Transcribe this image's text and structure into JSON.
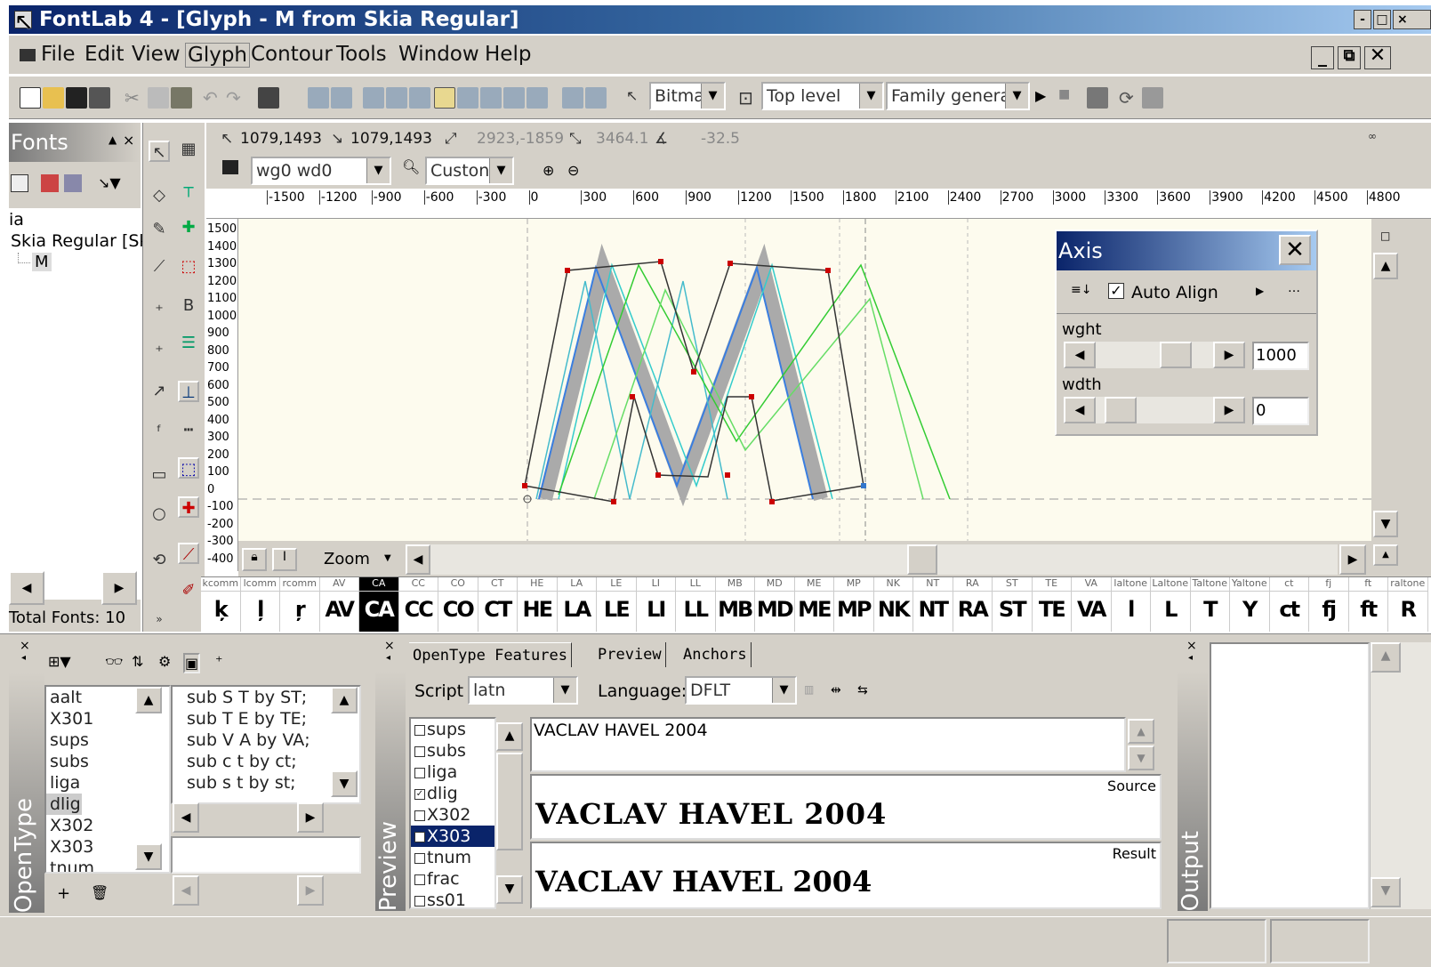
{
  "window": {
    "title": "FontLab 4 - [Glyph - M from Skia Regular]"
  },
  "menu": {
    "items": [
      "File",
      "Edit",
      "View",
      "Glyph",
      "Contour",
      "Tools",
      "Window",
      "Help"
    ]
  },
  "toolbar": {
    "bitmap_combo": "Bitma",
    "layer_combo": "Top level",
    "family_combo": "Family genera"
  },
  "coords": {
    "pos1": "1079,1493",
    "pos2": "1079,1493",
    "delta": "2923,-1859",
    "distance": "3464.1",
    "angle": "-32.5"
  },
  "mask": {
    "name_combo": "wg0 wd0",
    "view_combo": "Custon"
  },
  "ruler": {
    "h_ticks": [
      "-1500",
      "-1200",
      "-900",
      "-600",
      "-300",
      "0",
      "300",
      "600",
      "900",
      "1200",
      "1500",
      "1800",
      "2100",
      "2400",
      "2700",
      "3000",
      "3300",
      "3600",
      "3900",
      "4200",
      "4500",
      "4800"
    ],
    "v_ticks": [
      "1500",
      "1400",
      "1300",
      "1200",
      "1100",
      "1000",
      "900",
      "800",
      "700",
      "600",
      "500",
      "400",
      "300",
      "200",
      "100",
      "0",
      "-100",
      "-200",
      "-300",
      "-400"
    ]
  },
  "fonts_panel": {
    "title": "Fonts",
    "tree_root": "ia",
    "font_name": "Skia Regular [Sk",
    "glyph": "M",
    "total": "Total Fonts: 10"
  },
  "zoom": {
    "label": "Zoom"
  },
  "glyph_strip": {
    "headers": [
      "kcomm",
      "lcomm",
      "rcomm",
      "AV",
      "CA",
      "CC",
      "CO",
      "CT",
      "HE",
      "LA",
      "LE",
      "LI",
      "LL",
      "MB",
      "MD",
      "ME",
      "MP",
      "NK",
      "NT",
      "RA",
      "ST",
      "TE",
      "VA",
      "laltone",
      "Laltone",
      "Taltone",
      "Yaltone",
      "ct",
      "fj",
      "ft",
      "raltone"
    ],
    "glyphs": [
      "ķ",
      "ļ",
      "ŗ",
      "AV",
      "CA",
      "CC",
      "CO",
      "CT",
      "HE",
      "LA",
      "LE",
      "LI",
      "LL",
      "MB",
      "MD",
      "ME",
      "MP",
      "NK",
      "NT",
      "RA",
      "ST",
      "TE",
      "VA",
      "l",
      "L",
      "T",
      "Y",
      "ct",
      "fj",
      "ft",
      "R"
    ],
    "selected_index": 4
  },
  "axis_panel": {
    "title": "Axis",
    "auto_align": "Auto Align",
    "auto_align_checked": true,
    "axes": [
      {
        "name": "wght",
        "value": "1000",
        "level": 0.75
      },
      {
        "name": "wdth",
        "value": "0",
        "level": 0.1
      }
    ]
  },
  "opentype_panel": {
    "label": "OpenType",
    "features": [
      "aalt",
      "X301",
      "sups",
      "subs",
      "liga",
      "dlig",
      "X302",
      "X303",
      "tnum"
    ],
    "selected_feature": "dlig",
    "code": [
      "sub S T by ST;",
      "sub T E by TE;",
      "sub V A by VA;",
      "sub c t by ct;",
      "sub s t by st;"
    ]
  },
  "preview_panel": {
    "label": "Preview",
    "tabs": [
      "OpenType Features",
      "Preview",
      "Anchors"
    ],
    "script_label": "Script",
    "script_value": "latn",
    "language_label": "Language:",
    "language_value": "DFLT",
    "features": [
      {
        "name": "sups",
        "checked": false
      },
      {
        "name": "subs",
        "checked": false
      },
      {
        "name": "liga",
        "checked": false
      },
      {
        "name": "dlig",
        "checked": true
      },
      {
        "name": "X302",
        "checked": false
      },
      {
        "name": "X303",
        "checked": true,
        "selected": true
      },
      {
        "name": "tnum",
        "checked": false
      },
      {
        "name": "frac",
        "checked": false
      },
      {
        "name": "ss01",
        "checked": false
      }
    ],
    "input_text": "VACLAV HAVEL 2004",
    "source_label": "Source",
    "source_text": "VACLAV HAVEL 2004",
    "result_label": "Result",
    "result_text": "VACLAV HAVEL 2004"
  },
  "output_panel": {
    "label": "Output"
  },
  "colors": {
    "title_start": "#0a246a",
    "title_end": "#a6caf0",
    "canvas": "#fdfbee",
    "selection": "#0a246a",
    "node": "#cc0000"
  }
}
